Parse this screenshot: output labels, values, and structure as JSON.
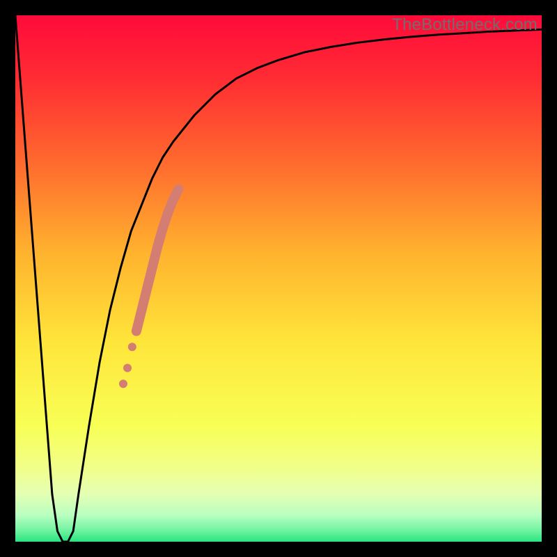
{
  "watermark": "TheBottleneck.com",
  "chart_data": {
    "type": "line",
    "title": "",
    "xlabel": "",
    "ylabel": "",
    "xlim": [
      0,
      100
    ],
    "ylim": [
      0,
      100
    ],
    "grid": false,
    "legend": "none",
    "background_gradient": {
      "top": "#ff0a3a",
      "upper_mid": "#ff8a2a",
      "mid": "#ffe53a",
      "lower_mid": "#f5ff6a",
      "near_bottom": "#c8ffb0",
      "bottom": "#28e57e"
    },
    "series": [
      {
        "name": "bottleneck-curve",
        "color": "#000000",
        "x": [
          0,
          2,
          4,
          6,
          7,
          8,
          9,
          10,
          11,
          12,
          14,
          16,
          18,
          20,
          22,
          24,
          26,
          28,
          30,
          34,
          38,
          42,
          46,
          50,
          55,
          60,
          65,
          70,
          75,
          80,
          85,
          90,
          95,
          100
        ],
        "y": [
          100,
          74,
          48,
          22,
          9,
          2,
          0,
          0,
          2,
          9,
          22,
          34,
          44,
          52,
          59,
          64,
          69,
          73,
          76,
          81,
          85,
          88,
          90,
          91.5,
          93,
          94,
          94.8,
          95.4,
          95.9,
          96.3,
          96.6,
          96.9,
          97.1,
          97.3
        ]
      }
    ],
    "markers": {
      "name": "highlight-segment",
      "color": "#d47d72",
      "points": [
        {
          "x": 20.5,
          "y": 30,
          "r": 6
        },
        {
          "x": 21.3,
          "y": 33,
          "r": 6
        },
        {
          "x": 22.2,
          "y": 37,
          "r": 6
        }
      ],
      "thick_segment": {
        "x": [
          23,
          24,
          25,
          26,
          27,
          28,
          29,
          30,
          31
        ],
        "y": [
          40,
          44,
          48,
          52,
          56,
          59.5,
          62.5,
          65,
          67
        ],
        "width": 14
      }
    }
  }
}
